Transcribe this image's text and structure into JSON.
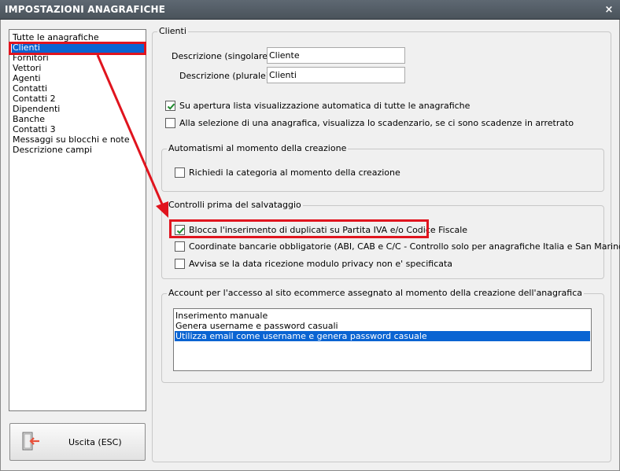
{
  "window": {
    "title": "IMPOSTAZIONI ANAGRAFICHE",
    "close_glyph": "×"
  },
  "nav": {
    "items": [
      {
        "label": "Tutte le anagrafiche",
        "selected": false
      },
      {
        "label": "Clienti",
        "selected": true
      },
      {
        "label": "Fornitori",
        "selected": false
      },
      {
        "label": "Vettori",
        "selected": false
      },
      {
        "label": "Agenti",
        "selected": false
      },
      {
        "label": "Contatti",
        "selected": false
      },
      {
        "label": "Contatti 2",
        "selected": false
      },
      {
        "label": "Dipendenti",
        "selected": false
      },
      {
        "label": "Banche",
        "selected": false
      },
      {
        "label": "Contatti 3",
        "selected": false
      },
      {
        "label": "Messaggi su blocchi e note",
        "selected": false
      },
      {
        "label": "Descrizione campi",
        "selected": false
      }
    ]
  },
  "exit_button": {
    "label": "Uscita (ESC)",
    "icon": "exit-door-icon"
  },
  "clienti": {
    "legend": "Clienti",
    "desc_singolare": {
      "label": "Descrizione (singolare) :",
      "value": "Cliente"
    },
    "desc_plurale": {
      "label": "Descrizione (plurale) :",
      "value": "Clienti"
    },
    "checkboxes": [
      {
        "label": "Su apertura lista visualizzazione automatica di tutte le anagrafiche",
        "checked": true
      },
      {
        "label": "Alla selezione di una anagrafica, visualizza lo scadenzario, se ci sono scadenze in arretrato",
        "checked": false
      }
    ]
  },
  "automatismi": {
    "legend": "Automatismi al momento della creazione",
    "checkboxes": [
      {
        "label": "Richiedi la categoria al momento della creazione",
        "checked": false
      }
    ]
  },
  "controlli": {
    "legend": "Controlli prima del salvataggio",
    "checkboxes": [
      {
        "label": "Blocca l'inserimento di duplicati su Partita IVA e/o Codice Fiscale",
        "checked": true
      },
      {
        "label": "Coordinate bancarie obbligatorie (ABI, CAB e C/C - Controllo solo per anagrafiche Italia e San Marino)",
        "checked": false
      },
      {
        "label": "Avvisa se la data ricezione modulo privacy non e' specificata",
        "checked": false
      }
    ]
  },
  "account": {
    "legend": "Account per l'accesso al sito ecommerce assegnato al momento della creazione dell'anagrafica",
    "options": [
      {
        "label": "Inserimento manuale",
        "selected": false
      },
      {
        "label": "Genera username e password casuali",
        "selected": false
      },
      {
        "label": "Utilizza email come username e genera password casuale",
        "selected": true
      }
    ]
  },
  "colors": {
    "selection": "#0a64d2",
    "annotation": "#e0141e",
    "titlebar": "#4a535b"
  }
}
